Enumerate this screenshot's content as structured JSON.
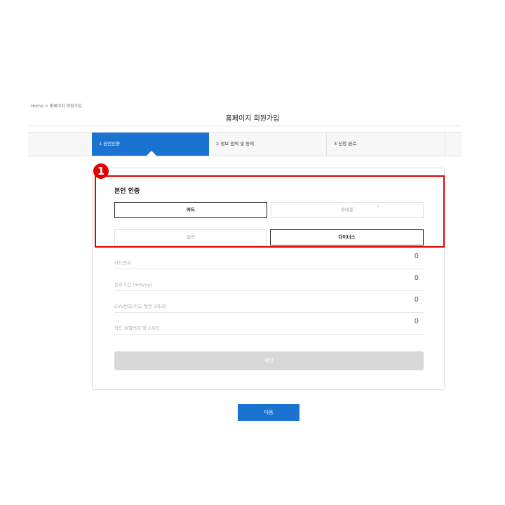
{
  "breadcrumb": {
    "home": "Home",
    "separator": ">",
    "current": "홈페이지 회원가입"
  },
  "page": {
    "title": "홈페이지 회원가입"
  },
  "steps": [
    {
      "label": "1 본인인증",
      "active": true
    },
    {
      "label": "2 정보 입력 및 동의",
      "active": false
    },
    {
      "label": "3 신청 완료",
      "active": false
    }
  ],
  "annotation": {
    "marker": "1"
  },
  "verification": {
    "title": "본인 인증",
    "method_tabs": [
      {
        "label": "카드",
        "selected": true
      },
      {
        "label": "휴대폰",
        "selected": false
      }
    ],
    "card_type_tabs": [
      {
        "label": "일반",
        "selected": false
      },
      {
        "label": "다이너스",
        "selected": true
      }
    ],
    "fields": [
      {
        "label": "카드번호",
        "count": "0"
      },
      {
        "label": "유효기간 (mm/yy)",
        "count": "0"
      },
      {
        "label": "CVV번호(카드 뒷면 3자리)",
        "count": "0"
      },
      {
        "label": "카드 비밀번호 앞 2자리",
        "count": "0"
      }
    ],
    "confirm_label": "확인"
  },
  "next_label": "다음",
  "colors": {
    "accent": "#1a73d1",
    "highlight": "#e00000",
    "disabled": "#d8d8d8"
  }
}
